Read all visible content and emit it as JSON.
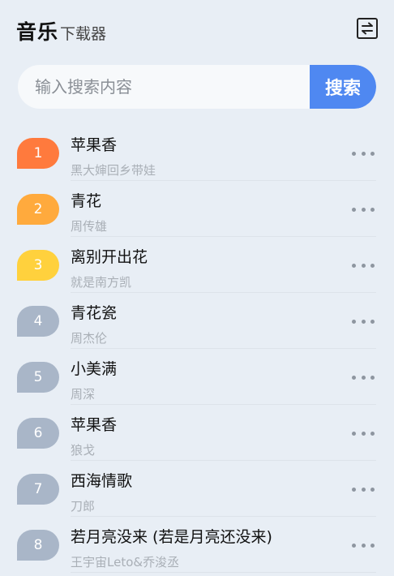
{
  "header": {
    "title_main": "音乐",
    "title_sub": "下载器",
    "switch_icon": "swap-arrows-icon"
  },
  "search": {
    "placeholder": "输入搜索内容",
    "value": "",
    "button_label": "搜索"
  },
  "colors": {
    "background": "#e8eef5",
    "accent": "#4f88f1",
    "rank_1": "#ff7a3d",
    "rank_2": "#ffaa3d",
    "rank_3": "#ffd13d",
    "rank_other": "#a9b6c8"
  },
  "songs": [
    {
      "rank": "1",
      "title": "苹果香",
      "artist": "黑大婶回乡带娃",
      "badge_color": "#ff7a3d"
    },
    {
      "rank": "2",
      "title": "青花",
      "artist": "周传雄",
      "badge_color": "#ffaa3d"
    },
    {
      "rank": "3",
      "title": "离别开出花",
      "artist": "就是南方凯",
      "badge_color": "#ffd13d"
    },
    {
      "rank": "4",
      "title": "青花瓷",
      "artist": "周杰伦",
      "badge_color": "#a9b6c8"
    },
    {
      "rank": "5",
      "title": "小美满",
      "artist": "周深",
      "badge_color": "#a9b6c8"
    },
    {
      "rank": "6",
      "title": "苹果香",
      "artist": "狼戈",
      "badge_color": "#a9b6c8"
    },
    {
      "rank": "7",
      "title": "西海情歌",
      "artist": "刀郎",
      "badge_color": "#a9b6c8"
    },
    {
      "rank": "8",
      "title": "若月亮没来 (若是月亮还没来)",
      "artist": "王宇宙Leto&乔浚丞",
      "badge_color": "#a9b6c8"
    }
  ]
}
